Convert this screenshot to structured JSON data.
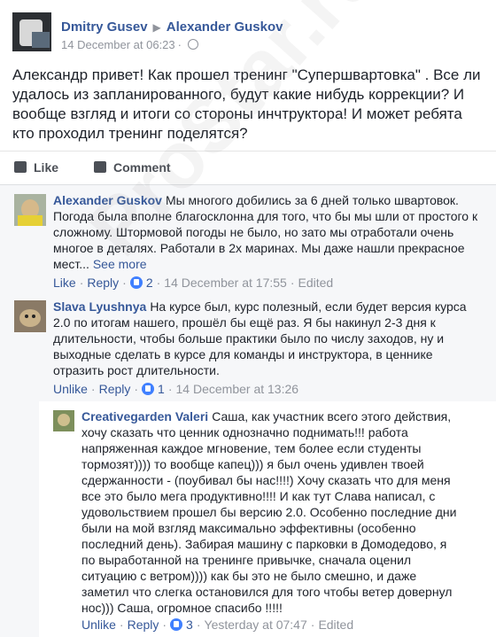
{
  "post": {
    "author": "Dmitry Gusev",
    "recipient": "Alexander Guskov",
    "arrow": "▶",
    "timestamp": "14 December at 06:23",
    "text": "Александр привет! Как прошел тренинг \"Супершвартовка\" . Все ли удалось из запланированного, будут какие нибудь коррекции? И вообще взгляд и итоги со стороны инчтруктора! И может ребята кто проходил тренинг поделятся?"
  },
  "actions": {
    "like": "Like",
    "comment": "Comment"
  },
  "comments": [
    {
      "author": "Alexander Guskov",
      "text": "Мы многого добились за 6 дней только швартовок. Погода была вполне благосклонна для того, что бы мы шли от простого к сложному. Штормовой погоды не было, но зато мы отработали очень многое в деталях. Работали в 2х маринах. Мы даже нашли прекрасное мест...",
      "see_more": "See more",
      "like_label": "Like",
      "reply_label": "Reply",
      "likes": "2",
      "timestamp": "14 December at 17:55",
      "edited": "Edited"
    },
    {
      "author": "Slava Lyushnya",
      "text": "На курсе был, курс полезный, если будет версия курса 2.0 по итогам нашего, прошёл бы ещё раз. Я бы накинул 2-3 дня к длительности, чтобы больше практики было по числу заходов, ну и выходные сделать в курсе для команды и инструктора, в ценнике отразить рост длительности.",
      "like_label": "Unlike",
      "reply_label": "Reply",
      "likes": "1",
      "timestamp": "14 December at 13:26"
    }
  ],
  "reply": {
    "author": "Creativegarden Valeri",
    "text": "Саша, как участник всего этого действия, хочу сказать что ценник однозначно поднимать!!! работа напряженная каждое мгновение, тем более если студенты тормозят)))) то вообще капец))) я был очень удивлен твоей сдержанности - (поубивал бы нас!!!!) Хочу сказать что для меня все это было мега продуктивно!!!! И как тут Слава написал, с удовольствием прошел бы версию 2.0. Особенно последние дни были на мой взгляд максимально эффективны (особенно последний день). Забирая машину с парковки в Домодедово, я по выработанной на тренинге привычке, сначала оценил ситуацию с ветром)))) как бы это не было смешно, и даже заметил что слегка остановился для того чтобы ветер довернул нос))) Саша, огромное спасибо !!!!!",
    "like_label": "Unlike",
    "reply_label": "Reply",
    "likes": "3",
    "timestamp": "Yesterday at 07:47",
    "edited": "Edited"
  },
  "watermark": "ProStar.ru",
  "colors": {
    "link": "#365899",
    "meta": "#90949c",
    "like_badge": "#4080ff",
    "comments_bg": "#f6f7f9"
  },
  "icons": [
    "globe-icon",
    "thumbs-up-icon",
    "comment-icon",
    "like-badge-icon"
  ]
}
